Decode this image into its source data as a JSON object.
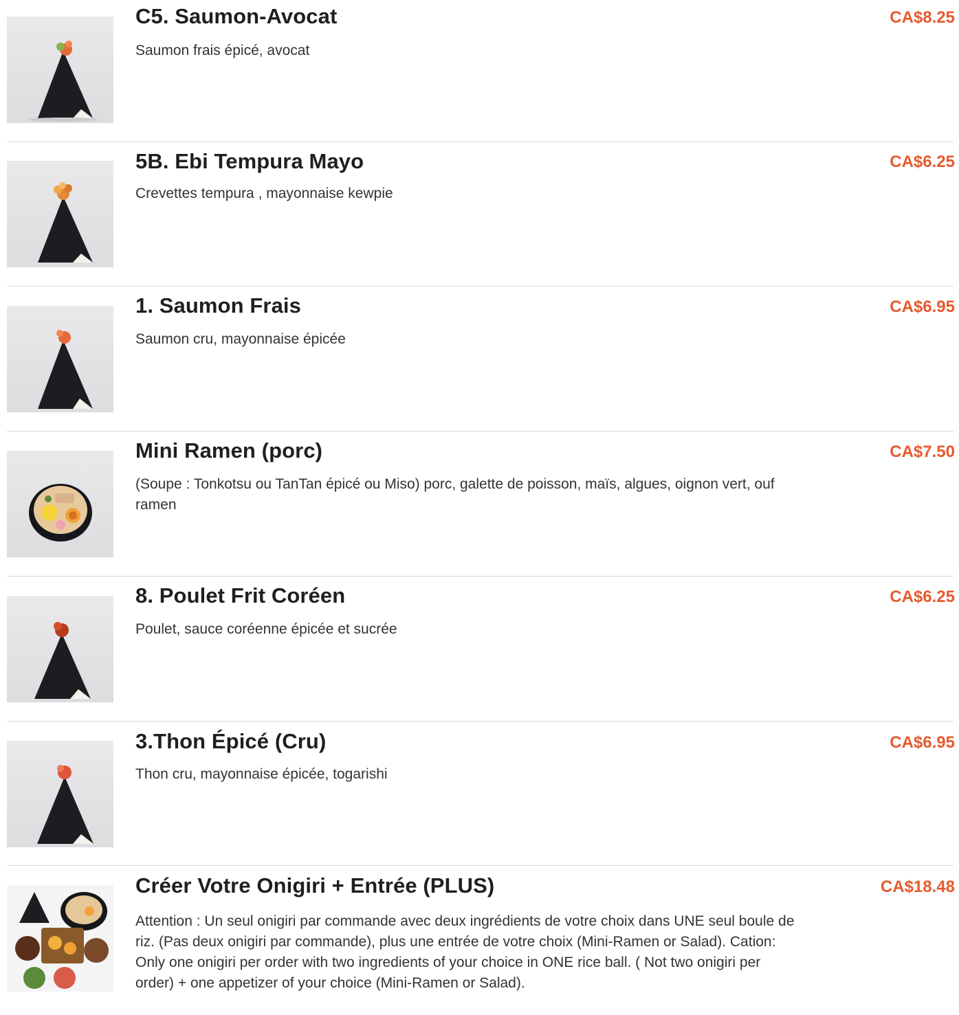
{
  "colors": {
    "price": "#e65a2d",
    "title": "#1f1f1f",
    "divider": "#d9d9d9"
  },
  "items": [
    {
      "title": "C5. Saumon-Avocat",
      "description": "Saumon frais épicé, avocat",
      "price": "CA$8.25",
      "image_icon": "onigiri-salmon-avocado-image"
    },
    {
      "title": "5B. Ebi Tempura Mayo",
      "description": "Crevettes tempura , mayonnaise kewpie",
      "price": "CA$6.25",
      "image_icon": "onigiri-tempura-image"
    },
    {
      "title": "1. Saumon Frais",
      "description": "Saumon cru, mayonnaise épicée",
      "price": "CA$6.95",
      "image_icon": "onigiri-salmon-image"
    },
    {
      "title": "Mini Ramen (porc)",
      "description": "(Soupe : Tonkotsu ou TanTan épicé ou Miso) porc, galette de poisson, maïs, algues, oignon vert, ouf ramen",
      "price": "CA$7.50",
      "image_icon": "ramen-bowl-image"
    },
    {
      "title": "8. Poulet Frit Coréen",
      "description": "Poulet, sauce coréenne épicée et sucrée",
      "price": "CA$6.25",
      "image_icon": "onigiri-chicken-image"
    },
    {
      "title": "3.Thon Épicé (Cru)",
      "description": "Thon cru, mayonnaise épicée, togarishi",
      "price": "CA$6.95",
      "image_icon": "onigiri-tuna-image"
    },
    {
      "title": "Créer Votre Onigiri + Entrée (PLUS)",
      "description": "Attention : Un seul onigiri par commande avec deux ingrédients de votre choix dans UNE seul boule de riz. (Pas deux onigiri par commande), plus une entrée de votre choix (Mini-Ramen or Salad). Cation: Only one onigiri per order with two ingredients of your choice in ONE rice ball. ( Not two onigiri per order) + one appetizer of your choice (Mini-Ramen or Salad).",
      "price": "CA$18.48",
      "image_icon": "combo-platter-image"
    }
  ]
}
